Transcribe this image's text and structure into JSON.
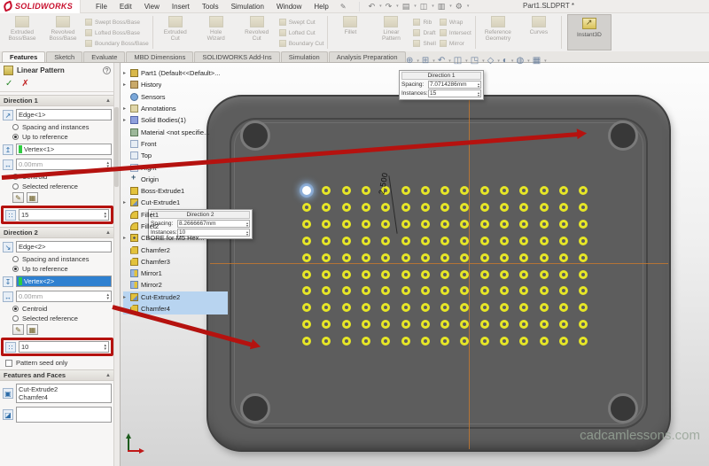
{
  "titlebar": {
    "logo_text": "SOLIDWORKS",
    "menus": [
      "File",
      "Edit",
      "View",
      "Insert",
      "Tools",
      "Simulation",
      "Window",
      "Help"
    ],
    "pin_icon": "pencil-pin-icon",
    "quick_icons": [
      {
        "name": "undo-icon",
        "glyph": "↶"
      },
      {
        "name": "redo-icon",
        "glyph": "↷"
      },
      {
        "name": "open-file-icon",
        "glyph": "▤"
      },
      {
        "name": "save-icon",
        "glyph": "◫"
      },
      {
        "name": "print-icon",
        "glyph": "▥"
      },
      {
        "name": "options-gear-icon",
        "glyph": "⚙"
      }
    ],
    "title": "Part1.SLDPRT *"
  },
  "ribbon": {
    "big1": [
      {
        "label": "Extruded\nBoss/Base"
      },
      {
        "label": "Revolved\nBoss/Base"
      }
    ],
    "small1": [
      {
        "label": "Swept Boss/Base"
      },
      {
        "label": "Lofted Boss/Base"
      },
      {
        "label": "Boundary Boss/Base"
      }
    ],
    "big2": [
      {
        "label": "Extruded\nCut"
      },
      {
        "label": "Hole\nWizard"
      },
      {
        "label": "Revolved\nCut"
      }
    ],
    "small2": [
      {
        "label": "Swept Cut"
      },
      {
        "label": "Lofted Cut"
      },
      {
        "label": "Boundary Cut"
      }
    ],
    "big3": [
      {
        "label": "Fillet"
      },
      {
        "label": "Linear\nPattern"
      }
    ],
    "small3": [
      {
        "label": "Rib"
      },
      {
        "label": "Draft"
      },
      {
        "label": "Shell"
      }
    ],
    "small4": [
      {
        "label": "Wrap"
      },
      {
        "label": "Intersect"
      },
      {
        "label": "Mirror"
      }
    ],
    "big4": [
      {
        "label": "Reference\nGeometry"
      },
      {
        "label": "Curves"
      }
    ],
    "active_button": "Instant3D"
  },
  "tabs": {
    "items": [
      {
        "label": "Features",
        "cls": "active"
      },
      {
        "label": "Sketch"
      },
      {
        "label": "Evaluate"
      },
      {
        "label": "MBD Dimensions"
      },
      {
        "label": "SOLIDWORKS Add-Ins"
      },
      {
        "label": "Simulation"
      },
      {
        "label": "Analysis Preparation"
      }
    ]
  },
  "panel": {
    "title": "Linear Pattern",
    "help_glyph": "?",
    "ok_glyph": "✓",
    "cancel_glyph": "✗",
    "dir1": {
      "header": "Direction 1",
      "edge": "Edge<1>",
      "opt_spacing": "Spacing and instances",
      "opt_upto": "Up to reference",
      "reference": "Vertex<1>",
      "offset": "0.00mm",
      "opt_centroid": "Centroid",
      "opt_selref": "Selected reference",
      "instances": "15"
    },
    "dir2": {
      "header": "Direction 2",
      "edge": "Edge<2>",
      "opt_spacing": "Spacing and instances",
      "opt_upto": "Up to reference",
      "reference": "Vertex<2>",
      "offset": "0.00mm",
      "opt_centroid": "Centroid",
      "opt_selref": "Selected reference",
      "instances": "10"
    },
    "seed_only_label": "Pattern seed only",
    "features_faces": {
      "header": "Features and Faces",
      "features": [
        "Cut-Extrude2",
        "Chamfer4"
      ],
      "faces": []
    }
  },
  "tree": {
    "items": [
      {
        "caret": "▸",
        "icon": "part",
        "label": "Part1 (Default<<Default>..."
      },
      {
        "caret": "▸",
        "icon": "history",
        "label": "History"
      },
      {
        "caret": "",
        "icon": "sensors",
        "label": "Sensors"
      },
      {
        "caret": "▸",
        "icon": "annotations",
        "label": "Annotations"
      },
      {
        "caret": "▸",
        "icon": "solids",
        "label": "Solid Bodies(1)"
      },
      {
        "caret": "",
        "icon": "material",
        "label": "Material <not specifie..."
      },
      {
        "caret": "",
        "icon": "plane",
        "label": "Front"
      },
      {
        "caret": "",
        "icon": "plane",
        "label": "Top"
      },
      {
        "caret": "",
        "icon": "plane",
        "label": "Right"
      },
      {
        "caret": "",
        "icon": "origin",
        "label": "Origin"
      },
      {
        "caret": "",
        "icon": "boss",
        "label": "Boss-Extrude1"
      },
      {
        "caret": "▸",
        "icon": "cut",
        "label": "Cut-Extrude1"
      },
      {
        "caret": "",
        "icon": "fillet",
        "label": "Fillet1"
      },
      {
        "caret": "",
        "icon": "fillet",
        "label": "Fillet2"
      },
      {
        "caret": "▸",
        "icon": "cbore",
        "label": "CBORE for M5 Hex..."
      },
      {
        "caret": "",
        "icon": "chamfer",
        "label": "Chamfer2"
      },
      {
        "caret": "",
        "icon": "chamfer",
        "label": "Chamfer3"
      },
      {
        "caret": "",
        "icon": "mirror",
        "label": "Mirror1"
      },
      {
        "caret": "",
        "icon": "mirror",
        "label": "Mirror2"
      },
      {
        "caret": "▸",
        "icon": "cut",
        "label": "Cut-Extrude2",
        "cls": "selected"
      },
      {
        "caret": "",
        "icon": "chamfer",
        "label": "Chamfer4",
        "cls": "selected"
      }
    ]
  },
  "callouts": {
    "d1": {
      "title": "Direction 1",
      "spacing_label": "Spacing:",
      "spacing": "7.0714286mm",
      "instances_label": "Instances:",
      "instances": "15"
    },
    "d2": {
      "title": "Direction 2",
      "spacing_label": "Spacing:",
      "spacing": "8.2666667mm",
      "instances_label": "Instances:",
      "instances": "10"
    }
  },
  "viewport": {
    "pattern": {
      "rows": 10,
      "cols": 15
    },
    "dimension": "2.500",
    "watermark": "cadcamlessons.com",
    "hud_icons": [
      {
        "name": "zoom-fit-icon",
        "glyph": "⊕"
      },
      {
        "name": "zoom-area-icon",
        "glyph": "⊞"
      },
      {
        "name": "previous-view-icon",
        "glyph": "↶"
      },
      {
        "name": "section-view-icon",
        "glyph": "◫"
      },
      {
        "name": "view-orientation-icon",
        "glyph": "◳"
      },
      {
        "name": "display-style-icon",
        "glyph": "◇"
      },
      {
        "name": "hide-show-icon",
        "glyph": "◐"
      },
      {
        "name": "appearance-icon",
        "glyph": "◍"
      },
      {
        "name": "scene-icon",
        "glyph": "▦"
      }
    ]
  },
  "colors": {
    "annotation_red": "#b5120f",
    "selection_blue": "#2f80d0",
    "highlight_green": "#2ecc40",
    "hole_yellow": "#e6e627",
    "plate_gray": "#5d5d5d",
    "crosshair_orange": "#c37830"
  }
}
